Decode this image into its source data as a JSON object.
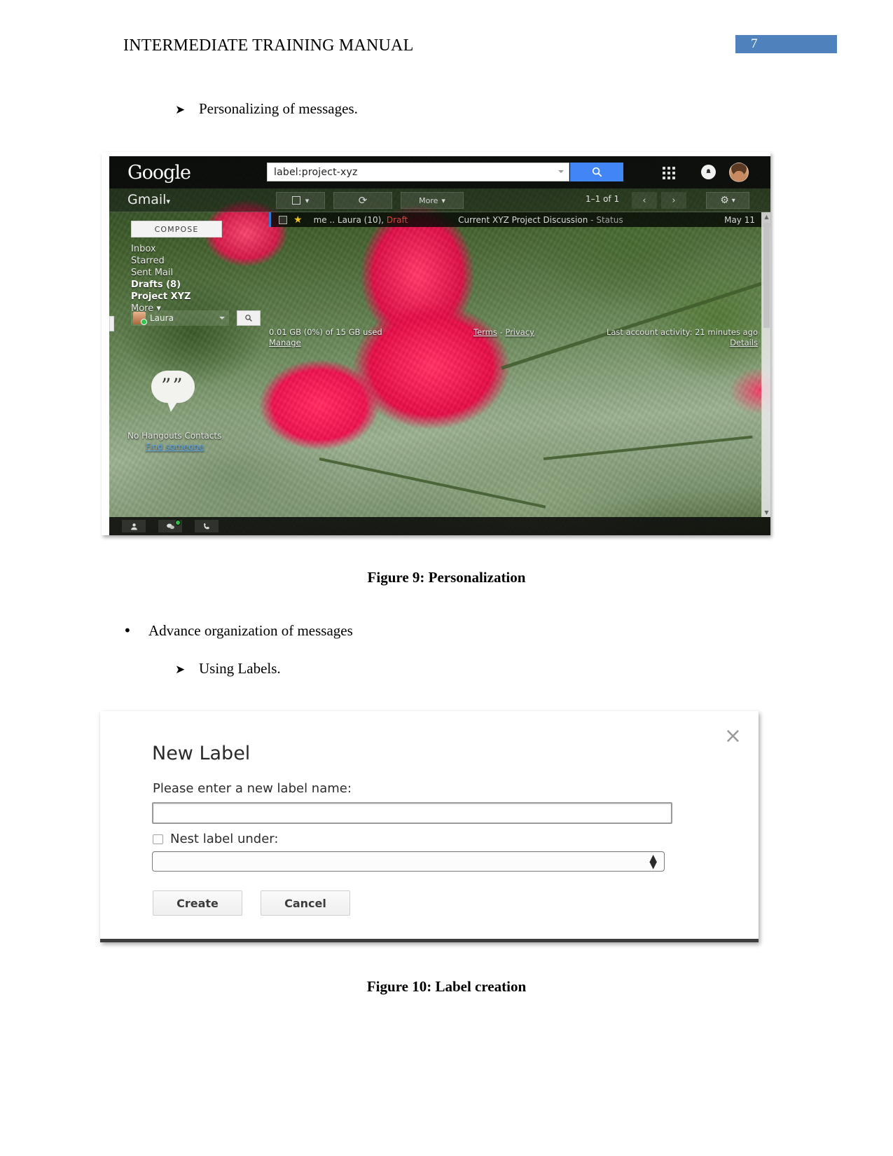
{
  "document": {
    "header_title": "INTERMEDIATE TRAINING MANUAL",
    "page_number": "7"
  },
  "content": {
    "bullet_personalizing": "Personalizing of messages.",
    "bullet_advance_org": "Advance organization of messages",
    "bullet_using_labels": "Using Labels.",
    "arrow_marker": "➤",
    "dot_marker": "•",
    "figure9_caption": "Figure 9: Personalization",
    "figure10_caption": "Figure 10: Label creation"
  },
  "gmail": {
    "logo": "Google",
    "search_query": "label:project-xyz",
    "product_name": "Gmail",
    "product_caret": "▾",
    "toolbar": {
      "select_caret": "▾",
      "refresh": "⟳",
      "more_label": "More",
      "more_caret": "▾",
      "pager": "1–1 of 1",
      "prev": "‹",
      "next": "›",
      "settings": "⚙",
      "settings_caret": "▾"
    },
    "compose_label": "COMPOSE",
    "nav_items": [
      {
        "label": "Inbox",
        "bold": false
      },
      {
        "label": "Starred",
        "bold": false
      },
      {
        "label": "Sent Mail",
        "bold": false
      },
      {
        "label": "Drafts (8)",
        "bold": true
      },
      {
        "label": "Project XYZ",
        "bold": true
      },
      {
        "label": "More ▾",
        "bold": false
      }
    ],
    "chat": {
      "user_name": "Laura",
      "caret": "▾"
    },
    "message_row": {
      "star": "★",
      "senders": "me .. Laura (10),",
      "draft_label": "Draft",
      "subject": "Current XYZ Project Discussion",
      "subject_separator": "-",
      "subject_status": "Status",
      "date": "May 11"
    },
    "footer": {
      "storage": "0.01 GB (0%) of 15 GB used",
      "manage": "Manage",
      "terms": "Terms",
      "terms_separator": "-",
      "privacy": "Privacy",
      "activity": "Last account activity: 21 minutes ago",
      "details": "Details"
    },
    "hangouts": {
      "bubble_glyph": "””",
      "no_contacts": "No Hangouts Contacts",
      "find_someone": "Find someone"
    }
  },
  "new_label_dialog": {
    "title": "New Label",
    "close_glyph": "×",
    "name_prompt": "Please enter a new label name:",
    "name_value": "",
    "nest_label": "Nest label under:",
    "nest_checked": false,
    "nest_value": "",
    "spinner_glyph": "⬍",
    "create_label": "Create",
    "cancel_label": "Cancel"
  },
  "colors": {
    "page_number_accent": "#4f81bd",
    "google_blue": "#4285f4",
    "draft_red": "#e1443c",
    "link_blue": "#5fa7ef",
    "star_yellow": "#f5c518"
  }
}
